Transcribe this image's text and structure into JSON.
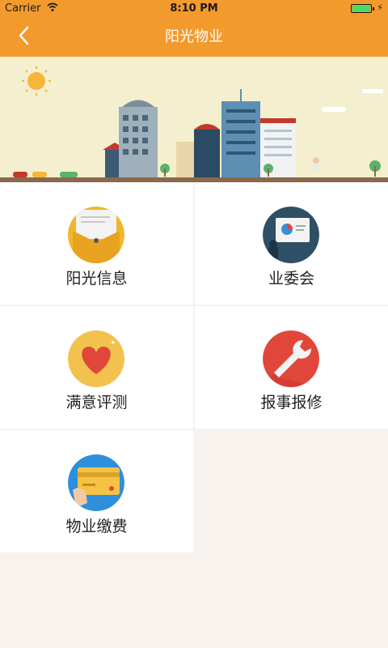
{
  "statusbar": {
    "carrier": "Carrier",
    "time": "8:10 PM"
  },
  "navbar": {
    "title": "阳光物业",
    "back_glyph": "‹"
  },
  "menu": {
    "items": [
      {
        "label": "阳光信息",
        "icon": "envelope-icon",
        "color": "#f2b62a"
      },
      {
        "label": "业委会",
        "icon": "presentation-icon",
        "color": "#2f4f66"
      },
      {
        "label": "满意评测",
        "icon": "heart-icon",
        "color": "#f2c14e"
      },
      {
        "label": "报事报修",
        "icon": "wrench-icon",
        "color": "#e0473a"
      },
      {
        "label": "物业缴费",
        "icon": "credit-card-icon",
        "color": "#2e8fdc"
      }
    ]
  },
  "colors": {
    "accent": "#f39a2c",
    "background": "#f8f2ee"
  }
}
